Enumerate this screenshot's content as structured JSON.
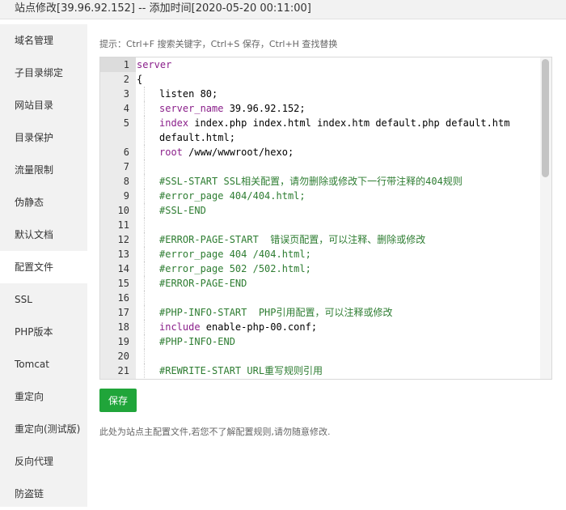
{
  "window": {
    "title": "站点修改[39.96.92.152] -- 添加时间[2020-05-20 00:11:00]"
  },
  "sidebar": {
    "items": [
      {
        "label": "域名管理"
      },
      {
        "label": "子目录绑定"
      },
      {
        "label": "网站目录"
      },
      {
        "label": "目录保护"
      },
      {
        "label": "流量限制"
      },
      {
        "label": "伪静态"
      },
      {
        "label": "默认文档"
      },
      {
        "label": "配置文件",
        "active": true
      },
      {
        "label": "SSL"
      },
      {
        "label": "PHP版本"
      },
      {
        "label": "Tomcat"
      },
      {
        "label": "重定向"
      },
      {
        "label": "重定向(测试版)"
      },
      {
        "label": "反向代理"
      },
      {
        "label": "防盗链"
      }
    ]
  },
  "main": {
    "hint": "提示：Ctrl+F 搜索关键字，Ctrl+S 保存，Ctrl+H 查找替换",
    "save_label": "保存",
    "footnote": "此处为站点主配置文件,若您不了解配置规则,请勿随意修改."
  },
  "editor": {
    "lines": [
      {
        "n": "1",
        "indent": 0,
        "parts": [
          {
            "t": "server",
            "c": "kw"
          }
        ]
      },
      {
        "n": "2",
        "indent": 0,
        "parts": [
          {
            "t": "{",
            "c": ""
          }
        ]
      },
      {
        "n": "3",
        "indent": 1,
        "parts": [
          {
            "t": "listen 80;",
            "c": ""
          }
        ]
      },
      {
        "n": "4",
        "indent": 1,
        "parts": [
          {
            "t": "server_name",
            "c": "kw"
          },
          {
            "t": " 39.96.92.152;",
            "c": ""
          }
        ]
      },
      {
        "n": "5",
        "indent": 1,
        "parts": [
          {
            "t": "index",
            "c": "kw"
          },
          {
            "t": " index.php index.html index.htm default.php default.htm default.html;",
            "c": ""
          }
        ],
        "wrap": 2
      },
      {
        "n": "6",
        "indent": 1,
        "parts": [
          {
            "t": "root",
            "c": "kw"
          },
          {
            "t": " /www/wwwroot/hexo;",
            "c": ""
          }
        ]
      },
      {
        "n": "7",
        "indent": 1,
        "parts": []
      },
      {
        "n": "8",
        "indent": 1,
        "parts": [
          {
            "t": "#SSL-START SSL相关配置，请勿删除或修改下一行带注释的404规则",
            "c": "cm"
          }
        ]
      },
      {
        "n": "9",
        "indent": 1,
        "parts": [
          {
            "t": "#error_page 404/404.html;",
            "c": "cm"
          }
        ]
      },
      {
        "n": "10",
        "indent": 1,
        "parts": [
          {
            "t": "#SSL-END",
            "c": "cm"
          }
        ]
      },
      {
        "n": "11",
        "indent": 1,
        "parts": []
      },
      {
        "n": "12",
        "indent": 1,
        "parts": [
          {
            "t": "#ERROR-PAGE-START  错误页配置，可以注释、删除或修改",
            "c": "cm"
          }
        ]
      },
      {
        "n": "13",
        "indent": 1,
        "parts": [
          {
            "t": "#error_page 404 /404.html;",
            "c": "cm"
          }
        ]
      },
      {
        "n": "14",
        "indent": 1,
        "parts": [
          {
            "t": "#error_page 502 /502.html;",
            "c": "cm"
          }
        ]
      },
      {
        "n": "15",
        "indent": 1,
        "parts": [
          {
            "t": "#ERROR-PAGE-END",
            "c": "cm"
          }
        ]
      },
      {
        "n": "16",
        "indent": 1,
        "parts": []
      },
      {
        "n": "17",
        "indent": 1,
        "parts": [
          {
            "t": "#PHP-INFO-START  PHP引用配置，可以注释或修改",
            "c": "cm"
          }
        ]
      },
      {
        "n": "18",
        "indent": 1,
        "parts": [
          {
            "t": "include",
            "c": "kw"
          },
          {
            "t": " enable-php-00.conf;",
            "c": ""
          }
        ]
      },
      {
        "n": "19",
        "indent": 1,
        "parts": [
          {
            "t": "#PHP-INFO-END",
            "c": "cm"
          }
        ]
      },
      {
        "n": "20",
        "indent": 1,
        "parts": []
      },
      {
        "n": "21",
        "indent": 1,
        "parts": [
          {
            "t": "#REWRITE-START URL重写规则引用",
            "c": "cm"
          }
        ]
      }
    ]
  }
}
